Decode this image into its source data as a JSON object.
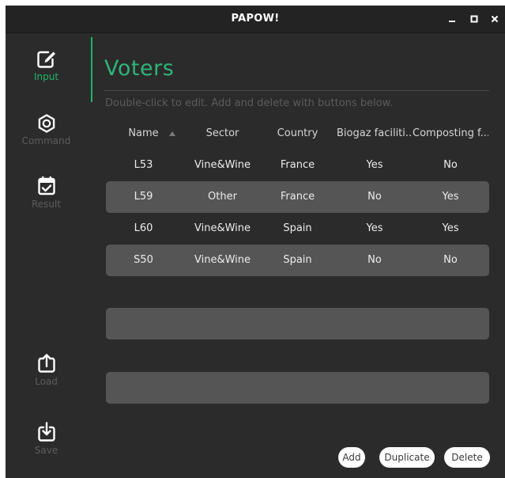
{
  "window": {
    "title": "PAPOW!"
  },
  "sidebar": {
    "items": [
      {
        "label": "Input",
        "icon": "edit-icon"
      },
      {
        "label": "Command",
        "icon": "gear-icon"
      },
      {
        "label": "Result",
        "icon": "calendar-check-icon"
      },
      {
        "label": "Load",
        "icon": "upload-icon"
      },
      {
        "label": "Save",
        "icon": "download-icon"
      }
    ],
    "accent_color": "#21b36b"
  },
  "main": {
    "title": "Voters",
    "hint": "Double-click to edit. Add and delete with buttons below."
  },
  "table": {
    "columns": [
      "Name",
      "Sector",
      "Country",
      "Biogaz faciliti...",
      "Composting f..."
    ],
    "sorted_column": "Name",
    "sort_direction": "ascending",
    "rows": [
      [
        "L53",
        "Vine&Wine",
        "France",
        "Yes",
        "No"
      ],
      [
        "L59",
        "Other",
        "France",
        "No",
        "Yes"
      ],
      [
        "L60",
        "Vine&Wine",
        "Spain",
        "Yes",
        "Yes"
      ],
      [
        "S50",
        "Vine&Wine",
        "Spain",
        "No",
        "No"
      ],
      [
        "",
        "",
        "",
        "",
        ""
      ],
      [
        "",
        "",
        "",
        "",
        ""
      ],
      [
        "",
        "",
        "",
        "",
        ""
      ],
      [
        "",
        "",
        "",
        "",
        ""
      ]
    ]
  },
  "buttons": {
    "add": "Add",
    "duplicate": "Duplicate",
    "delete": "Delete"
  }
}
